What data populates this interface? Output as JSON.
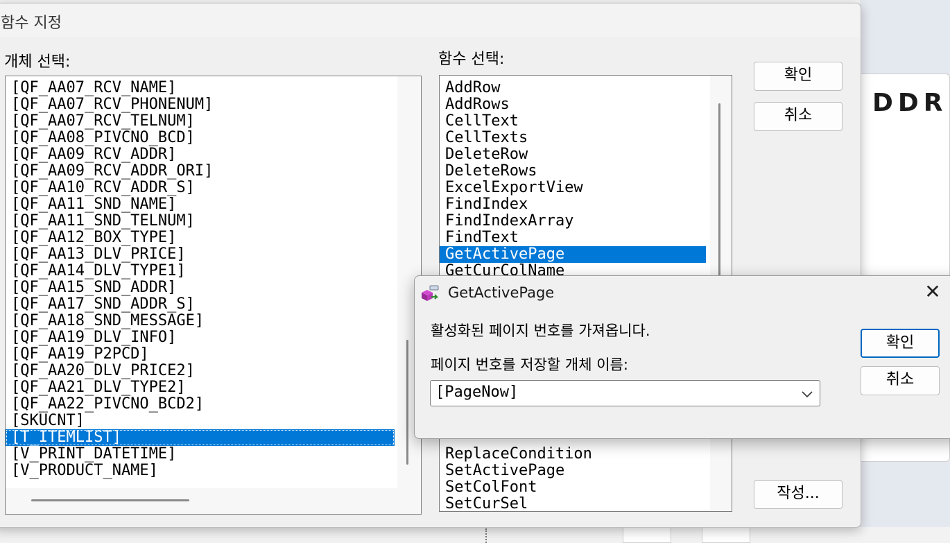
{
  "background": {
    "text": "DDR"
  },
  "main_dialog": {
    "title": "함수 지정",
    "object_label": "개체 선택:",
    "function_label": "함수 선택:",
    "ok_label": "확인",
    "cancel_label": "취소",
    "write_label": "작성...",
    "objects": [
      "[QF_AA07_RCV_NAME]",
      "[QF_AA07_RCV_PHONENUM]",
      "[QF_AA07_RCV_TELNUM]",
      "[QF_AA08_PIVCNO_BCD]",
      "[QF_AA09_RCV_ADDR]",
      "[QF_AA09_RCV_ADDR_ORI]",
      "[QF_AA10_RCV_ADDR_S]",
      "[QF_AA11_SND_NAME]",
      "[QF_AA11_SND_TELNUM]",
      "[QF_AA12_BOX_TYPE]",
      "[QF_AA13_DLV_PRICE]",
      "[QF_AA14_DLV_TYPE1]",
      "[QF_AA15_SND_ADDR]",
      "[QF_AA17_SND_ADDR_S]",
      "[QF_AA18_SND_MESSAGE]",
      "[QF_AA19_DLV_INFO]",
      "[QF_AA19_P2PCD]",
      "[QF_AA20_DLV_PRICE2]",
      "[QF_AA21_DLV_TYPE2]",
      "[QF_AA22_PIVCNO_BCD2]",
      "[SKUCNT]",
      "[T_ITEMLIST]",
      "[V_PRINT_DATETIME]",
      "[V_PRODUCT_NAME]"
    ],
    "selected_object": "[T_ITEMLIST]",
    "functions_top": [
      "AddRow",
      "AddRows",
      "CellText",
      "CellTexts",
      "DeleteRow",
      "DeleteRows",
      "ExcelExportView",
      "FindIndex",
      "FindIndexArray",
      "FindText",
      "GetActivePage",
      "GetCurColName"
    ],
    "functions_bottom": [
      "ReplaceCondition",
      "SetActivePage",
      "SetColFont",
      "SetCurSel"
    ],
    "selected_function": "GetActivePage"
  },
  "sub_dialog": {
    "title": "GetActivePage",
    "description": "활성화된  페이지 번호를 가져옵니다.",
    "field_label": "페이지 번호를 저장할 개체 이름:",
    "combo_value": "[PageNow]",
    "ok_label": "확인",
    "cancel_label": "취소"
  },
  "colors": {
    "selection": "#0078d7",
    "dialog_bg": "#f0f0f0",
    "primary_border": "#0067c0"
  }
}
